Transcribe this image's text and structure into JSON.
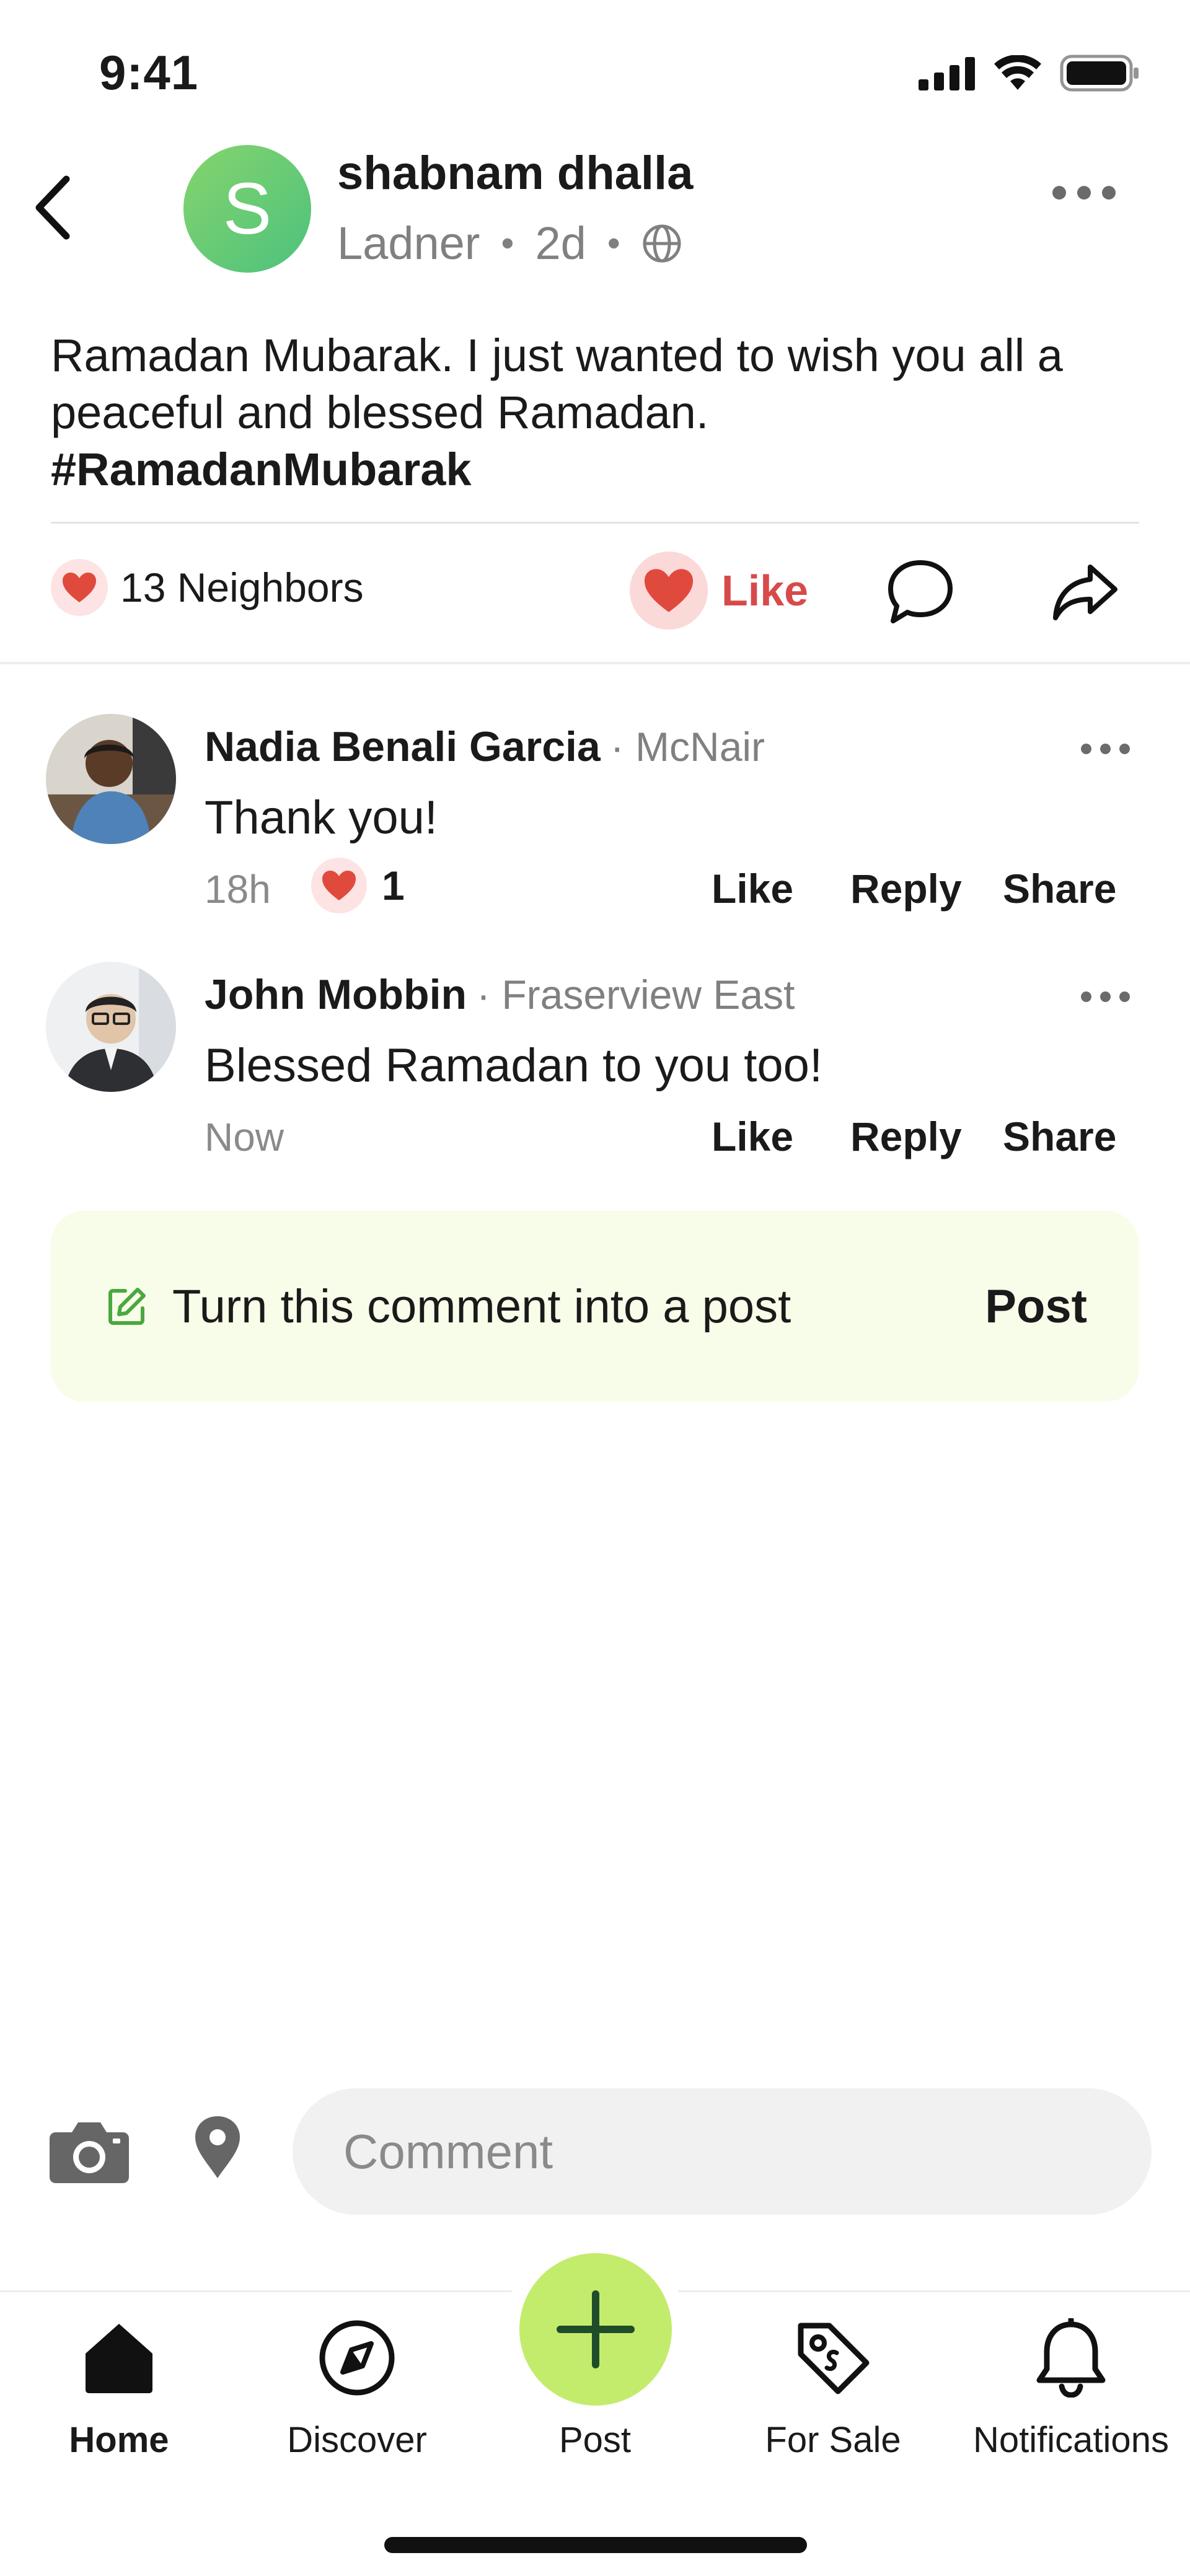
{
  "status_bar": {
    "time": "9:41"
  },
  "post": {
    "author_initial": "S",
    "author_name": "shabnam dhalla",
    "location": "Ladner",
    "age": "2d",
    "body": "Ramadan Mubarak. I just wanted to wish you all a peaceful and blessed Ramadan.",
    "hashtag": "#RamadanMubarak",
    "reaction_count_label": "13 Neighbors",
    "like_label": "Like",
    "avatar_color": "#5cc87a",
    "like_color": "#d84a4a"
  },
  "comments": [
    {
      "name": "Nadia Benali Garcia",
      "location": "· McNair",
      "text": "Thank you!",
      "time": "18h",
      "reaction_count": "1",
      "actions": {
        "like": "Like",
        "reply": "Reply",
        "share": "Share"
      }
    },
    {
      "name": "John Mobbin",
      "location": "· Fraserview East",
      "text": "Blessed Ramadan to you too!",
      "time": "Now",
      "actions": {
        "like": "Like",
        "reply": "Reply",
        "share": "Share"
      }
    }
  ],
  "turn_into_post": {
    "text": "Turn this comment into a post",
    "button": "Post",
    "background": "#f8fde9"
  },
  "composer": {
    "placeholder": "Comment"
  },
  "nav": {
    "items": [
      {
        "label": "Home",
        "icon": "home-icon",
        "active": true
      },
      {
        "label": "Discover",
        "icon": "compass-icon"
      },
      {
        "label": "Post",
        "icon": "plus-icon"
      },
      {
        "label": "For Sale",
        "icon": "tag-icon"
      },
      {
        "label": "Notifications",
        "icon": "bell-icon"
      }
    ],
    "fab_color": "#c3ec6c"
  }
}
